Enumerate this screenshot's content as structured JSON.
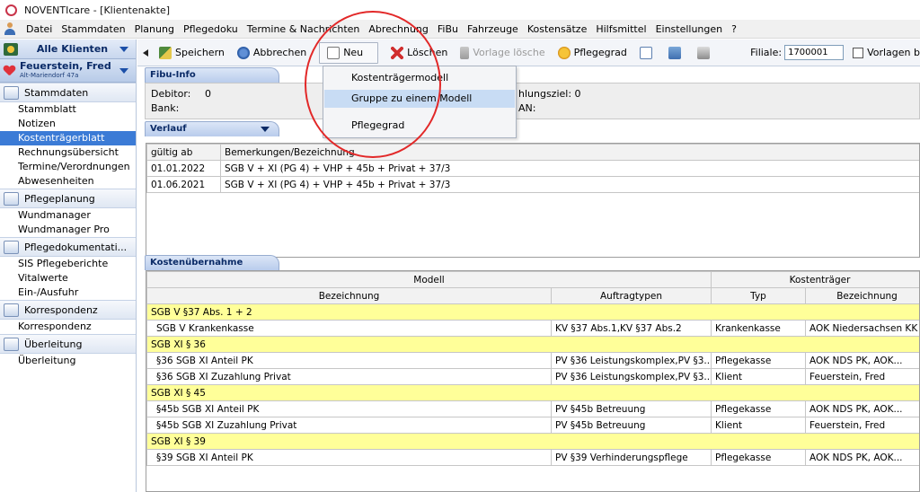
{
  "window": {
    "title": "NOVENTIcare - [Klientenakte]"
  },
  "menu": [
    "Datei",
    "Stammdaten",
    "Planung",
    "Pflegedoku",
    "Termine & Nachrichten",
    "Abrechnung",
    "FiBu",
    "Fahrzeuge",
    "Kostensätze",
    "Hilfsmittel",
    "Einstellungen",
    "?"
  ],
  "sidebar": {
    "client_selector": "Alle Klienten",
    "patient_name": "Feuerstein, Fred",
    "patient_address": "Alt-Mariendorf 47a",
    "sections": [
      {
        "label": "Stammdaten",
        "icon": "person-card-icon",
        "items": [
          "Stammblatt",
          "Notizen",
          "Kostenträgerblatt",
          "Rechnungsübersicht",
          "Termine/Verordnungen",
          "Abwesenheiten"
        ]
      },
      {
        "label": "Pflegeplanung",
        "icon": "planning-icon",
        "items": [
          "Wundmanager",
          "Wundmanager Pro"
        ]
      },
      {
        "label": "Pflegedokumentati...",
        "icon": "documentation-icon",
        "items": [
          "SIS Pflegeberichte",
          "Vitalwerte",
          "Ein-/Ausfuhr"
        ]
      },
      {
        "label": "Korrespondenz",
        "icon": "envelope-icon",
        "items": [
          "Korrespondenz"
        ]
      },
      {
        "label": "Überleitung",
        "icon": "transfer-icon",
        "items": [
          "Überleitung"
        ]
      }
    ],
    "selected_item": "Kostenträgerblatt"
  },
  "toolbar": {
    "save": "Speichern",
    "cancel": "Abbrechen",
    "new": "Neu",
    "delete": "Löschen",
    "delete_template": "Vorlage lösche",
    "care_grade": "Pflegegrad",
    "branch_label": "Filiale:",
    "branch_value": "1700001",
    "templates_label": "Vorlagen b"
  },
  "dropdown": {
    "items": [
      "Kostenträgermodell",
      "Gruppe zu einem Modell",
      "Pflegegrad"
    ],
    "hovered": "Gruppe zu einem Modell"
  },
  "fibu": {
    "header": "Fibu-Info",
    "debitor_label": "Debitor:",
    "debitor_value": "0",
    "bank_label": "Bank:",
    "payment_term_partial": "hlungsziel: 0",
    "iban_partial": "AN:"
  },
  "verlauf": {
    "header": "Verlauf",
    "columns": [
      "gültig ab",
      "Bemerkungen/Bezeichnung"
    ],
    "rows": [
      [
        "01.01.2022",
        "SGB V + XI (PG 4) + VHP + 45b + Privat + 37/3"
      ],
      [
        "01.06.2021",
        "SGB V + XI (PG 4) + VHP + 45b + Privat + 37/3"
      ]
    ]
  },
  "kosten": {
    "header": "Kostenübernahme",
    "group_headers": [
      "Modell",
      "Kostenträger"
    ],
    "columns": [
      "Bezeichnung",
      "Auftragtypen",
      "Typ",
      "Bezeichnung"
    ],
    "groups": [
      {
        "name": "SGB V §37 Abs. 1 + 2",
        "rows": [
          [
            "SGB V Krankenkasse",
            "KV §37 Abs.1,KV §37 Abs.2",
            "Krankenkasse",
            "AOK Niedersachsen KK"
          ]
        ]
      },
      {
        "name": "SGB XI § 36",
        "rows": [
          [
            "§36 SGB XI Anteil PK",
            "PV §36 Leistungskomplex,PV §3...",
            "Pflegekasse",
            "AOK NDS PK, AOK..."
          ],
          [
            "§36 SGB XI Zuzahlung Privat",
            "PV §36 Leistungskomplex,PV §3...",
            "Klient",
            "Feuerstein, Fred"
          ]
        ]
      },
      {
        "name": "SGB XI § 45",
        "rows": [
          [
            "§45b SGB XI Anteil PK",
            "PV §45b Betreuung",
            "Pflegekasse",
            "AOK NDS PK, AOK..."
          ],
          [
            "§45b SGB XI Zuzahlung Privat",
            "PV §45b Betreuung",
            "Klient",
            "Feuerstein, Fred"
          ]
        ]
      },
      {
        "name": "SGB XI § 39",
        "rows": [
          [
            "§39 SGB XI Anteil PK",
            "PV §39 Verhinderungspflege",
            "Pflegekasse",
            "AOK NDS PK, AOK..."
          ]
        ]
      }
    ]
  },
  "colors": {
    "selection": "#3b7bd6",
    "group_row": "#ffff99",
    "annotation": "#e22828",
    "hover": "#c8dcf4"
  }
}
